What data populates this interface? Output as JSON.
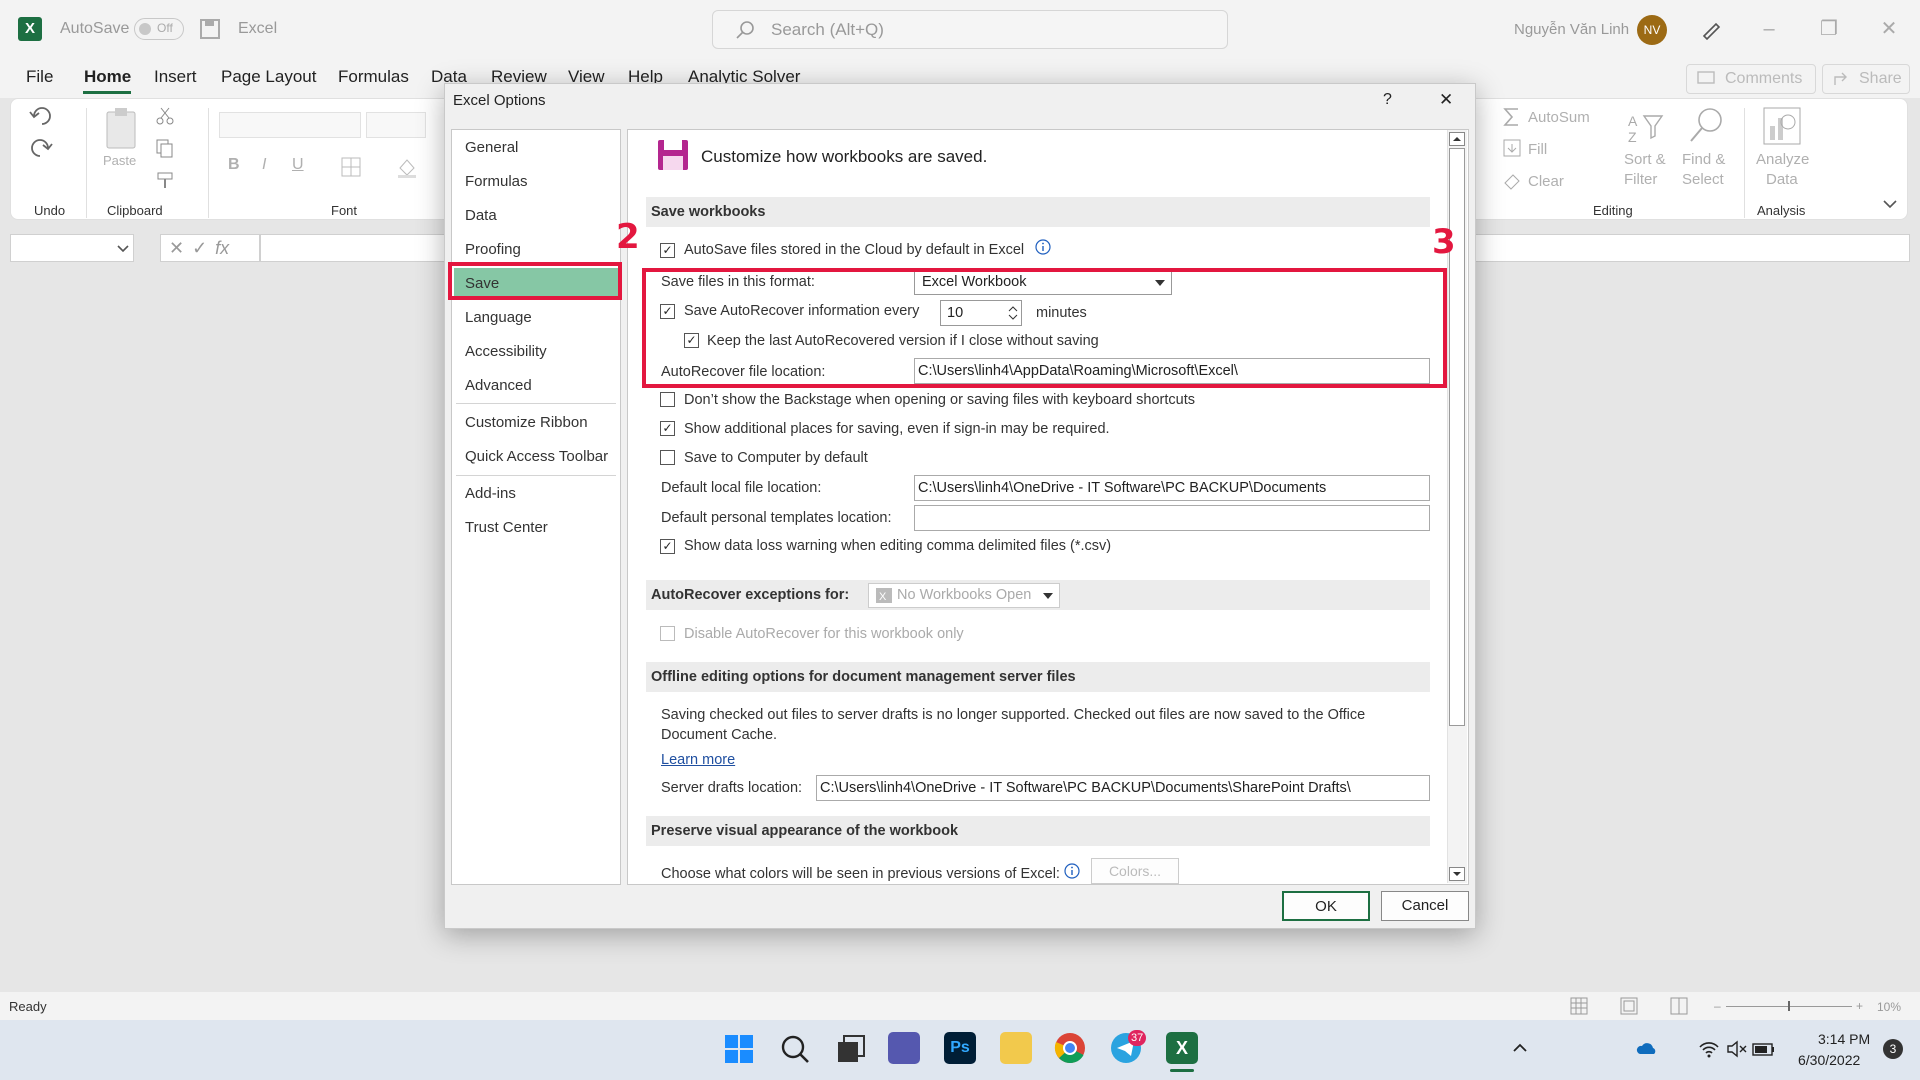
{
  "titlebar": {
    "app_icon": "X",
    "autosave_label": "AutoSave",
    "autosave_state": "Off",
    "app_title": "Excel",
    "search_placeholder": "Search (Alt+Q)",
    "user_name": "Nguyễn Văn Linh",
    "user_initials": "NV"
  },
  "menu": {
    "tabs": [
      "File",
      "Home",
      "Insert",
      "Page Layout",
      "Formulas",
      "Data",
      "Review",
      "View",
      "Help",
      "Analytic Solver"
    ],
    "comments": "Comments",
    "share": "Share"
  },
  "ribbon": {
    "undo_group": "Undo",
    "paste": "Paste",
    "clipboard_group": "Clipboard",
    "font_group": "Font",
    "bold": "B",
    "italic": "I",
    "underline": "U",
    "autosum": "AutoSum",
    "fill": "Fill",
    "clear": "Clear",
    "sort_filter_1": "Sort &",
    "sort_filter_2": "Filter",
    "find_select_1": "Find &",
    "find_select_2": "Select",
    "editing_group": "Editing",
    "analyze_1": "Analyze",
    "analyze_2": "Data",
    "analysis_group": "Analysis"
  },
  "formula_bar": {
    "fx": "fx"
  },
  "status": {
    "ready": "Ready",
    "zoom": "10%"
  },
  "taskbar": {
    "time": "3:14 PM",
    "date": "6/30/2022",
    "telegram_badge": "37",
    "notif_count": "3"
  },
  "dialog": {
    "title": "Excel Options",
    "help": "?",
    "close": "✕",
    "nav": [
      "General",
      "Formulas",
      "Data",
      "Proofing",
      "Save",
      "Language",
      "Accessibility",
      "Advanced",
      "Customize Ribbon",
      "Quick Access Toolbar",
      "Add-ins",
      "Trust Center"
    ],
    "header": "Customize how workbooks are saved.",
    "save_section": "Save workbooks",
    "autosave_cloud": "AutoSave files stored in the Cloud by default in Excel",
    "save_format_label": "Save files in this format:",
    "save_format_value": "Excel Workbook",
    "autorecover_label": "Save AutoRecover information every",
    "autorecover_minutes": "10",
    "minutes": "minutes",
    "keep_last": "Keep the last AutoRecovered version if I close without saving",
    "ar_location_label": "AutoRecover file location:",
    "ar_location_value": "C:\\Users\\linh4\\AppData\\Roaming\\Microsoft\\Excel\\",
    "dont_show_backstage": "Don’t show the Backstage when opening or saving files with keyboard shortcuts",
    "show_additional": "Show additional places for saving, even if sign-in may be required.",
    "save_computer": "Save to Computer by default",
    "default_local_label": "Default local file location:",
    "default_local_value": "C:\\Users\\linh4\\OneDrive - IT Software\\PC BACKUP\\Documents",
    "templates_label": "Default personal templates location:",
    "templates_value": "",
    "data_loss": "Show data loss warning when editing comma delimited files (*.csv)",
    "exceptions_section": "AutoRecover exceptions for:",
    "no_workbooks": "No Workbooks Open",
    "disable_ar": "Disable AutoRecover for this workbook only",
    "offline_section": "Offline editing options for document management server files",
    "offline_text_1": "Saving checked out files to server drafts is no longer supported. Checked out files are now saved to the Office",
    "offline_text_2": "Document Cache.",
    "learn_more": "Learn more",
    "server_drafts_label": "Server drafts location:",
    "server_drafts_value": "C:\\Users\\linh4\\OneDrive - IT Software\\PC BACKUP\\Documents\\SharePoint Drafts\\",
    "preserve_section": "Preserve visual appearance of the workbook",
    "colors_label": "Choose what colors will be seen in previous versions of Excel:",
    "colors_button": "Colors...",
    "ok": "OK",
    "cancel": "Cancel"
  },
  "annotations": {
    "step2": "2",
    "step3": "3",
    "color": "#e3173f"
  }
}
